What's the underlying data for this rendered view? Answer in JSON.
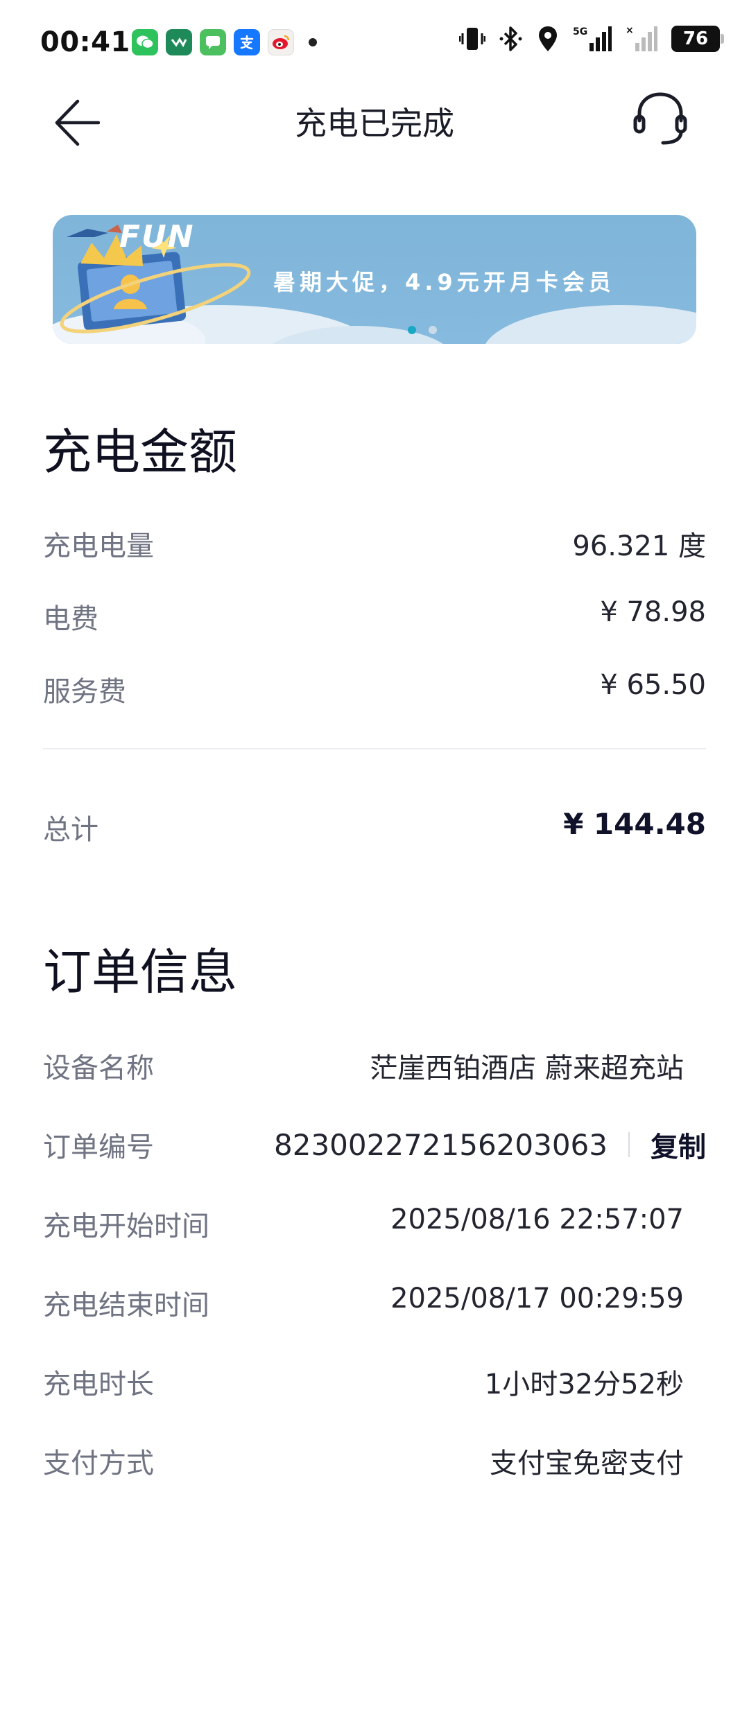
{
  "status_bar": {
    "time": "00:41",
    "apps": [
      {
        "icon": "wechat-icon",
        "color": "#2dc25c",
        "glyph": "●"
      },
      {
        "icon": "wecom-icon",
        "color": "#1e8a5a",
        "glyph": "◆"
      },
      {
        "icon": "messages-icon",
        "color": "#4cc05e",
        "glyph": "■"
      },
      {
        "icon": "alipay-icon",
        "color": "#1677ff",
        "glyph": "支"
      },
      {
        "icon": "weibo-icon",
        "color": "#f5d94a",
        "glyph": "◉"
      }
    ],
    "signal": "5G",
    "battery": "76"
  },
  "header": {
    "title": "充电已完成",
    "back_icon": "back-arrow-icon",
    "service_icon": "headset-icon"
  },
  "banner": {
    "logo_text": "FUN",
    "text": "暑期大促，4.9元开月卡会员",
    "slide_count": 2,
    "active_slide": 1
  },
  "charge": {
    "title": "充电金额",
    "rows": [
      {
        "label": "充电电量",
        "value": "96.321 度"
      },
      {
        "label": "电费",
        "value": "¥ 78.98"
      },
      {
        "label": "服务费",
        "value": "¥ 65.50"
      }
    ],
    "total_label": "总计",
    "total_value": "¥ 144.48"
  },
  "order": {
    "title": "订单信息",
    "device_label": "设备名称",
    "device_value": "茫崖西铂酒店 蔚来超充站",
    "number_label": "订单编号",
    "number_value": "823002272156203063",
    "copy_label": "复制",
    "start_label": "充电开始时间",
    "start_value": "2025/08/16 22:57:07",
    "end_label": "充电结束时间",
    "end_value": "2025/08/17 00:29:59",
    "duration_label": "充电时长",
    "duration_value": "1小时32分52秒",
    "payment_label": "支付方式",
    "payment_value": "支付宝免密支付"
  }
}
